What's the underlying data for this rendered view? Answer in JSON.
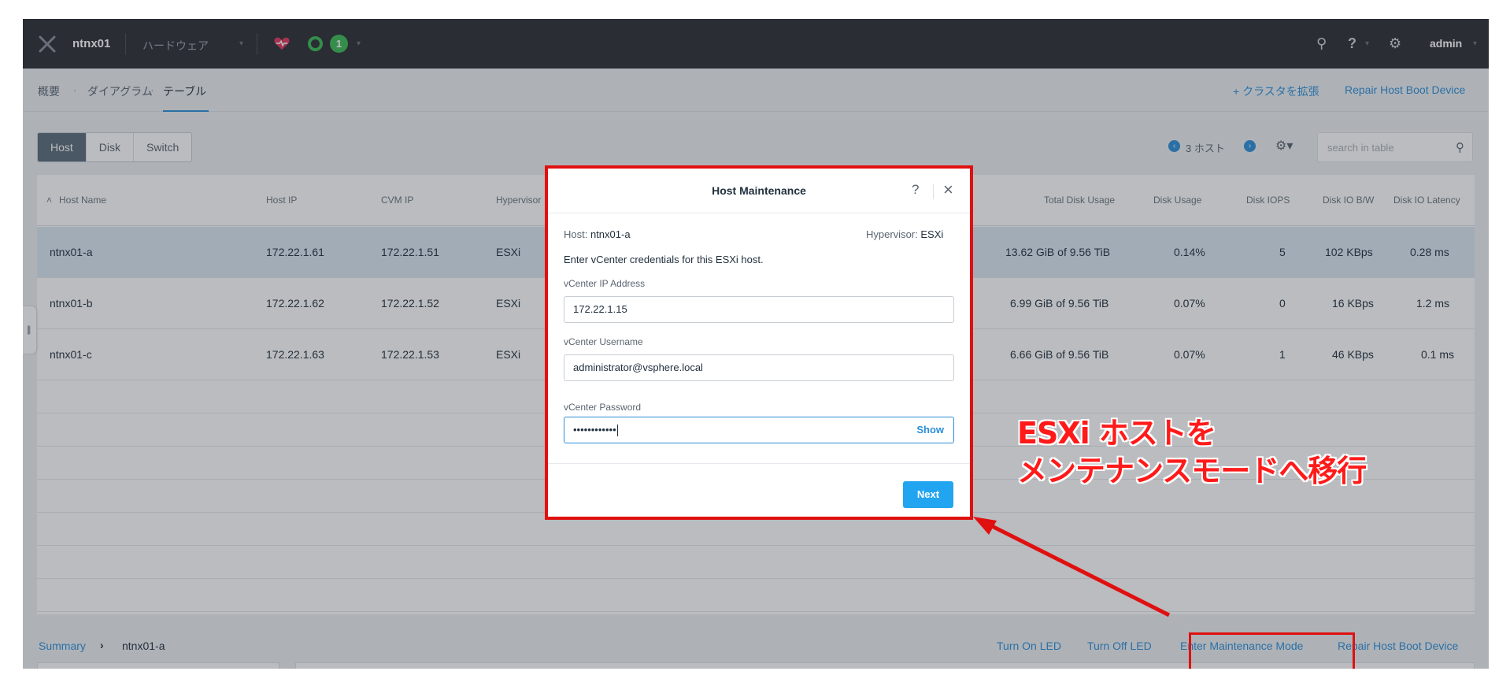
{
  "topnav": {
    "cluster_name": "ntnx01",
    "view_label": "ハードウェア",
    "alert_count": "1",
    "user_label": "admin"
  },
  "subnav": {
    "crumbs": [
      "概要",
      "ダイアグラム",
      "テーブル"
    ],
    "expand_cluster": "+ クラスタを拡張",
    "repair_host_boot": "Repair Host Boot Device"
  },
  "toolbar": {
    "tabs": [
      "Host",
      "Disk",
      "Switch"
    ],
    "pager_text": "3 ホスト",
    "search_placeholder": "search in table"
  },
  "table": {
    "columns": {
      "host_name": "Host Name",
      "host_ip": "Host IP",
      "cvm_ip": "CVM IP",
      "hypervisor": "Hypervisor",
      "total_disk_usage": "Total Disk Usage",
      "disk_usage": "Disk Usage",
      "disk_iops": "Disk IOPS",
      "disk_io_bw": "Disk IO B/W",
      "disk_io_latency": "Disk IO Latency"
    },
    "rows": [
      {
        "name": "ntnx01-a",
        "host_ip": "172.22.1.61",
        "cvm_ip": "172.22.1.51",
        "hypervisor": "ESXi",
        "total_disk": "13.62 GiB of 9.56 TiB",
        "disk_usage": "0.14%",
        "iops": "5",
        "bw": "102 KBps",
        "latency": "0.28 ms"
      },
      {
        "name": "ntnx01-b",
        "host_ip": "172.22.1.62",
        "cvm_ip": "172.22.1.52",
        "hypervisor": "ESXi",
        "total_disk": "6.99 GiB of 9.56 TiB",
        "disk_usage": "0.07%",
        "iops": "0",
        "bw": "16 KBps",
        "latency": "1.2 ms"
      },
      {
        "name": "ntnx01-c",
        "host_ip": "172.22.1.63",
        "cvm_ip": "172.22.1.53",
        "hypervisor": "ESXi",
        "total_disk": "6.66 GiB of 9.56 TiB",
        "disk_usage": "0.07%",
        "iops": "1",
        "bw": "46 KBps",
        "latency": "0.1 ms"
      }
    ]
  },
  "bottombar": {
    "summary": "Summary",
    "host": "ntnx01-a",
    "actions": [
      "Turn On LED",
      "Turn Off LED",
      "Enter Maintenance Mode",
      "Repair Host Boot Device"
    ]
  },
  "modal": {
    "title": "Host Maintenance",
    "help": "?",
    "host_label": "Host:",
    "host_value": "ntnx01-a",
    "hypervisor_label": "Hypervisor:",
    "hypervisor_value": "ESXi",
    "instruction": "Enter vCenter credentials for this ESXi host.",
    "ip_label": "vCenter IP Address",
    "ip_value": "172.22.1.15",
    "user_label": "vCenter Username",
    "user_value": "administrator@vsphere.local",
    "password_label": "vCenter Password",
    "password_value": "••••••••••••",
    "show_label": "Show",
    "next_label": "Next"
  },
  "annotation": {
    "line1": "ESXi ホストを",
    "line2": "メンテナンスモードへ移行"
  },
  "colors": {
    "accent": "#2c8ed9",
    "nav_bg": "#2b2d33",
    "highlight_red": "#e01010",
    "health_green": "#3cba54"
  }
}
